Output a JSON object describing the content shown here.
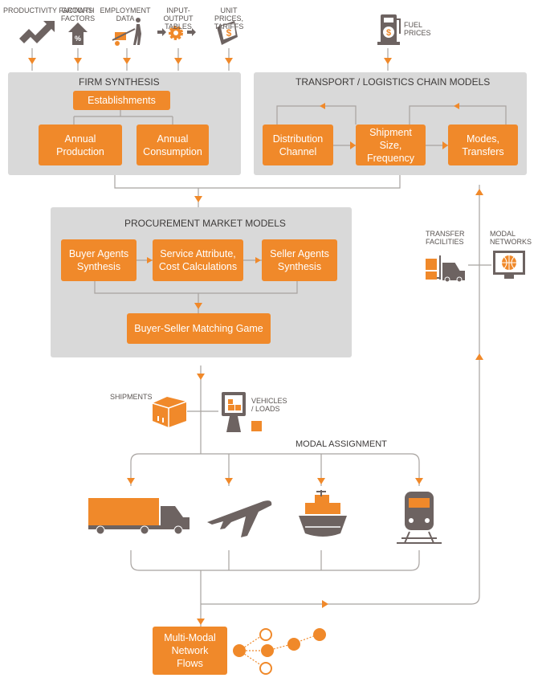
{
  "colors": {
    "accent": "#f0892a",
    "panel": "#d9d9d9",
    "icon": "#6d6361",
    "line": "#a8a3a0"
  },
  "inputs": [
    {
      "label": "PRODUCTIVITY FACTORS",
      "icon": "trend-arrow-icon"
    },
    {
      "label": "GROWTH FACTORS",
      "icon": "percent-arrow-icon"
    },
    {
      "label": "EMPLOYMENT DATA",
      "icon": "worker-hand-truck-icon"
    },
    {
      "label": "INPUT-OUTPUT TABLES",
      "icon": "gear-arrows-icon"
    },
    {
      "label": "UNIT PRICES, TARIFFS",
      "icon": "price-tag-icon"
    }
  ],
  "fuel": {
    "label": "FUEL PRICES",
    "icon": "fuel-pump-icon"
  },
  "firm": {
    "title": "FIRM SYNTHESIS",
    "establishments": "Establishments",
    "production": "Annual Production",
    "consumption": "Annual Consumption"
  },
  "transport": {
    "title": "TRANSPORT / LOGISTICS CHAIN MODELS",
    "distribution": "Distribution Channel",
    "shipment": "Shipment Size, Frequency",
    "modes": "Modes, Transfers"
  },
  "procurement": {
    "title": "PROCUREMENT MARKET MODELS",
    "buyer": "Buyer Agents Synthesis",
    "service": "Service Attribute, Cost Calculations",
    "seller": "Seller Agents Synthesis",
    "matching": "Buyer-Seller Matching Game"
  },
  "shipments": "SHIPMENTS",
  "vehicles": "VEHICLES / LOADS",
  "modal_assignment": "MODAL ASSIGNMENT",
  "modes": [
    "truck-icon",
    "airplane-icon",
    "ship-icon",
    "train-icon"
  ],
  "transfer": "TRANSFER FACILITIES",
  "networks": "MODAL NETWORKS",
  "flows": "Multi-Modal Network Flows"
}
